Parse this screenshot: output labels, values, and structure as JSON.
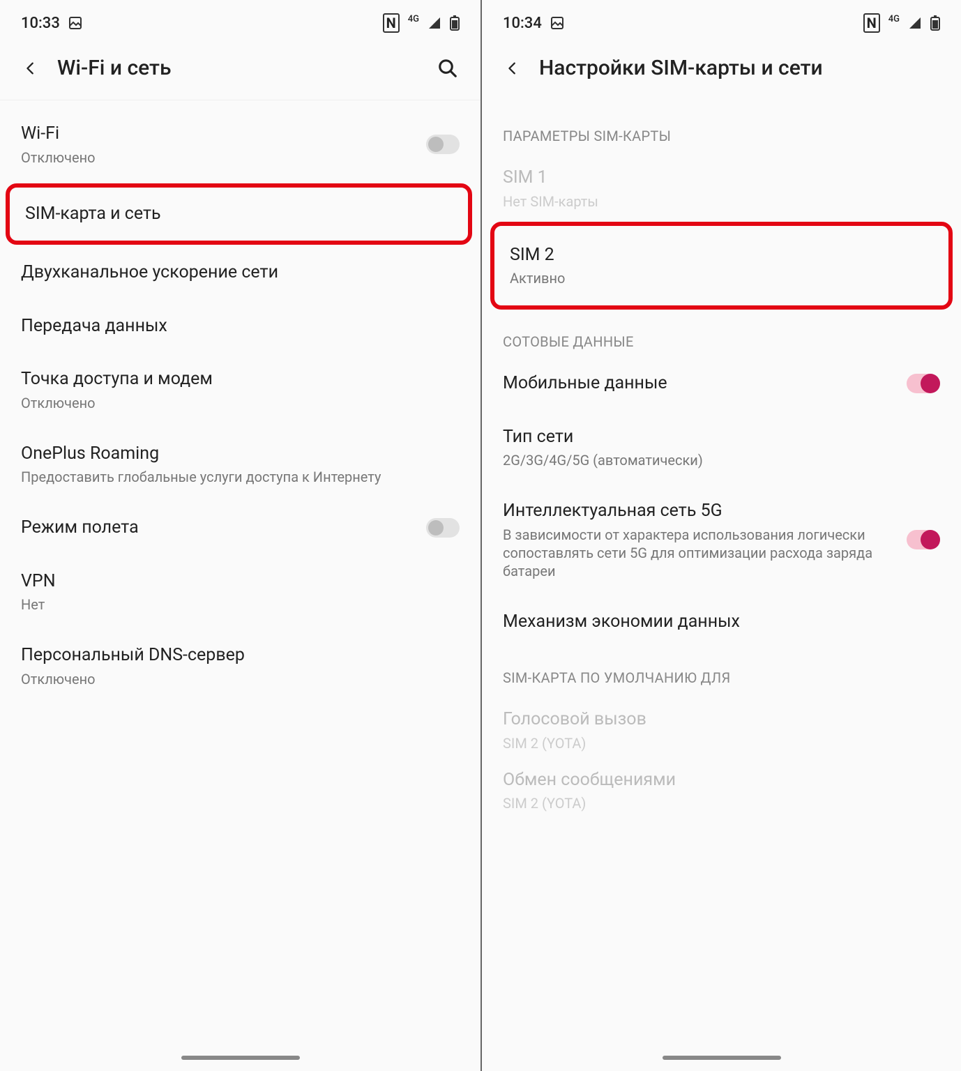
{
  "left": {
    "status_time": "10:33",
    "title": "Wi-Fi и сеть",
    "items": {
      "wifi": {
        "title": "Wi-Fi",
        "sub": "Отключено"
      },
      "sim": {
        "title": "SIM-карта и сеть"
      },
      "dualch": {
        "title": "Двухканальное ускорение сети"
      },
      "data": {
        "title": "Передача данных"
      },
      "hotspot": {
        "title": "Точка доступа и модем",
        "sub": "Отключено"
      },
      "roaming": {
        "title": "OnePlus Roaming",
        "sub": "Предоставить глобальные услуги доступа к Интернету"
      },
      "airplane": {
        "title": "Режим полета"
      },
      "vpn": {
        "title": "VPN",
        "sub": "Нет"
      },
      "dns": {
        "title": "Персональный DNS-сервер",
        "sub": "Отключено"
      }
    }
  },
  "right": {
    "status_time": "10:34",
    "title": "Настройки SIM-карты и сети",
    "sections": {
      "sim_params": "ПАРАМЕТРЫ SIM-КАРТЫ",
      "cell_data": "СОТОВЫЕ ДАННЫЕ",
      "default_for": "SIM-КАРТА ПО УМОЛЧАНИЮ ДЛЯ"
    },
    "items": {
      "sim1": {
        "title": "SIM 1",
        "sub": "Нет SIM-карты"
      },
      "sim2": {
        "title": "SIM 2",
        "sub": "Активно"
      },
      "mobdata": {
        "title": "Мобильные данные"
      },
      "nettype": {
        "title": "Тип сети",
        "sub": "2G/3G/4G/5G (автоматически)"
      },
      "smart5g": {
        "title": "Интеллектуальная сеть 5G",
        "sub": "В зависимости от характера использования логически сопоставлять сети 5G для оптимизации расхода заряда батареи"
      },
      "datasaver": {
        "title": "Механизм экономии данных"
      },
      "voice": {
        "title": "Голосовой вызов",
        "sub": "SIM 2  (YOTA)"
      },
      "sms": {
        "title": "Обмен сообщениями",
        "sub": "SIM 2  (YOTA)"
      }
    }
  },
  "status_icons": {
    "nfc_label": "N",
    "net_label": "4G"
  }
}
